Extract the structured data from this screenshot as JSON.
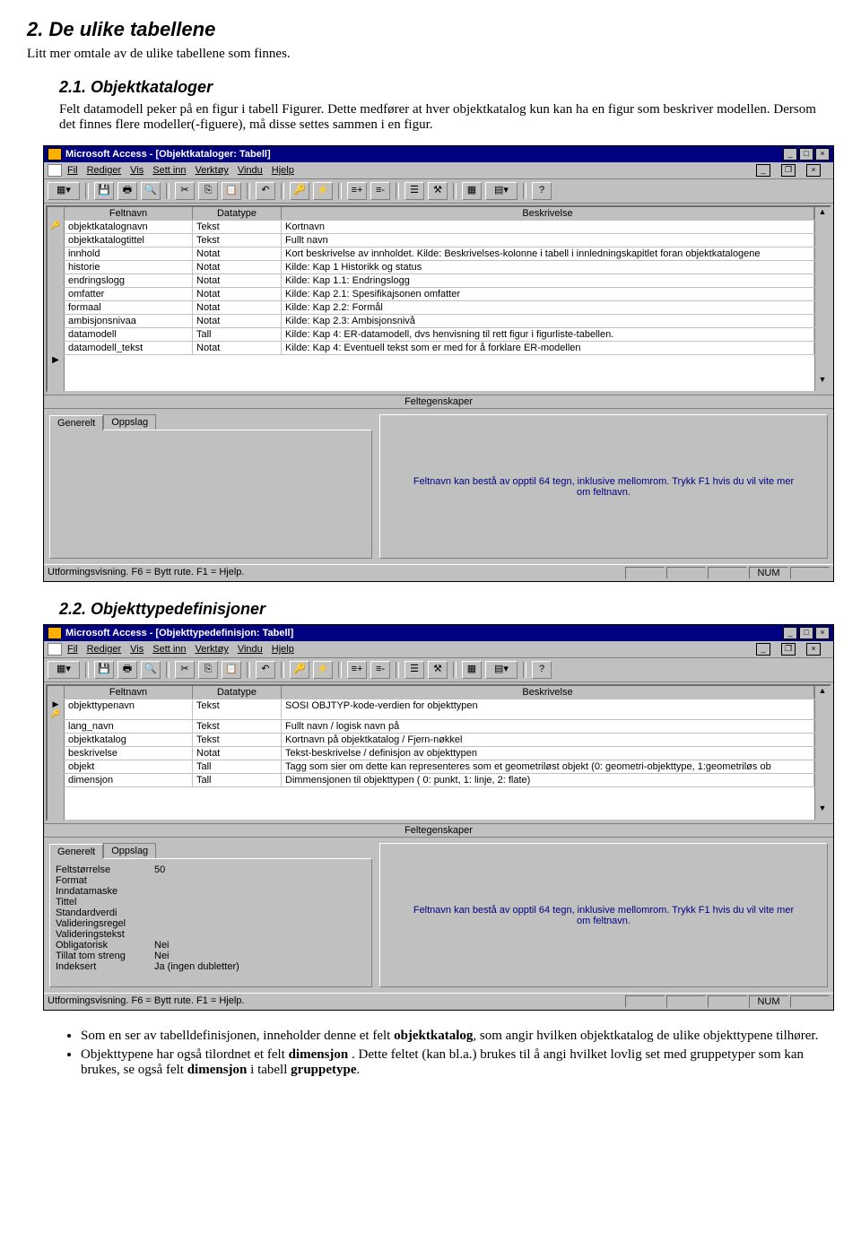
{
  "doc": {
    "h2": "2.  De ulike tabellene",
    "intro": "Litt mer omtale av de ulike tabellene som finnes.",
    "s21_title": "2.1.  Objektkataloger",
    "s21_text": "Felt datamodell peker på en figur i tabell Figurer. Dette medfører at hver objektkatalog kun kan ha en figur som beskriver modellen. Dersom det finnes flere modeller(-figuere), må disse settes sammen i en figur.",
    "s22_title": "2.2.  Objekttypedefinisjoner",
    "bullet1_a": "Som en ser av tabelldefinisjonen, inneholder denne et felt ",
    "bullet1_bold": "objektkatalog",
    "bullet1_b": ", som angir hvilken objektkatalog de ulike objekttypene tilhører.",
    "bullet2_a": "Objekttypene har også tilordnet et felt ",
    "bullet2_bold": "dimensjon",
    "bullet2_b": " . Dette feltet (kan bl.a.) brukes til å angi hvilket lovlig set med gruppetyper som kan brukes, se også felt ",
    "bullet2_bold2": "dimensjon",
    "bullet2_c": " i tabell ",
    "bullet2_bold3": "gruppetype",
    "bullet2_d": "."
  },
  "win1": {
    "title": "Microsoft Access - [Objektkataloger: Tabell]",
    "menu": [
      "Fil",
      "Rediger",
      "Vis",
      "Sett inn",
      "Verktøy",
      "Vindu",
      "Hjelp"
    ],
    "headers": [
      "Feltnavn",
      "Datatype",
      "Beskrivelse"
    ],
    "rows": [
      {
        "pk": true,
        "f": "objektkatalognavn",
        "d": "Tekst",
        "b": "Kortnavn"
      },
      {
        "f": "objektkatalogtittel",
        "d": "Tekst",
        "b": "Fullt navn"
      },
      {
        "f": "innhold",
        "d": "Notat",
        "b": "Kort beskrivelse av innholdet. Kilde: Beskrivelses-kolonne i tabell i innledningskapitlet foran objektkatalogene"
      },
      {
        "f": "historie",
        "d": "Notat",
        "b": "Kilde: Kap 1 Historikk og status"
      },
      {
        "f": "endringslogg",
        "d": "Notat",
        "b": "Kilde: Kap 1.1: Endringslogg"
      },
      {
        "f": "omfatter",
        "d": "Notat",
        "b": "Kilde: Kap 2.1: Spesifikajsonen omfatter"
      },
      {
        "f": "formaal",
        "d": "Notat",
        "b": "Kilde: Kap 2.2: Formål"
      },
      {
        "f": "ambisjonsnivaa",
        "d": "Notat",
        "b": "Kilde: Kap 2.3: Ambisjonsnivå"
      },
      {
        "f": "datamodell",
        "d": "Tall",
        "b": "Kilde: Kap 4: ER-datamodell, dvs henvisning til rett figur i figurliste-tabellen."
      },
      {
        "f": "datamodell_tekst",
        "d": "Notat",
        "b": "Kilde: Kap 4: Eventuell tekst som er med for å forklare ER-modellen"
      }
    ],
    "section_label": "Feltegenskaper",
    "tab1": "Generelt",
    "tab2": "Oppslag",
    "help": "Feltnavn kan bestå av opptil 64 tegn, inklusive mellomrom. Trykk F1 hvis du vil vite mer om feltnavn.",
    "status": "Utformingsvisning. F6 = Bytt rute. F1 = Hjelp.",
    "num": "NUM"
  },
  "win2": {
    "title": "Microsoft Access - [Objekttypedefinisjon: Tabell]",
    "menu": [
      "Fil",
      "Rediger",
      "Vis",
      "Sett inn",
      "Verktøy",
      "Vindu",
      "Hjelp"
    ],
    "headers": [
      "Feltnavn",
      "Datatype",
      "Beskrivelse"
    ],
    "rows": [
      {
        "pk": true,
        "sel": true,
        "f": "objekttypenavn",
        "d": "Tekst",
        "b": "SOSI OBJTYP-kode-verdien for objekttypen"
      },
      {
        "f": "lang_navn",
        "d": "Tekst",
        "b": "Fullt navn / logisk navn på"
      },
      {
        "f": "objektkatalog",
        "d": "Tekst",
        "b": "Kortnavn på objektkatalog / Fjern-nøkkel"
      },
      {
        "f": "beskrivelse",
        "d": "Notat",
        "b": "Tekst-beskrivelse / definisjon av objekttypen"
      },
      {
        "f": "objekt",
        "d": "Tall",
        "b": "Tagg som sier om dette kan representeres som et geometriløst objekt (0: geometri-objekttype, 1:geometriløs ob"
      },
      {
        "f": "dimensjon",
        "d": "Tall",
        "b": "Dimmensjonen til objekttypen ( 0: punkt, 1: linje, 2: flate)"
      }
    ],
    "section_label": "Feltegenskaper",
    "tab1": "Generelt",
    "tab2": "Oppslag",
    "props": [
      {
        "l": "Feltstørrelse",
        "v": "50"
      },
      {
        "l": "Format",
        "v": ""
      },
      {
        "l": "Inndatamaske",
        "v": ""
      },
      {
        "l": "Tittel",
        "v": ""
      },
      {
        "l": "Standardverdi",
        "v": ""
      },
      {
        "l": "Valideringsregel",
        "v": ""
      },
      {
        "l": "Valideringstekst",
        "v": ""
      },
      {
        "l": "Obligatorisk",
        "v": "Nei"
      },
      {
        "l": "Tillat tom streng",
        "v": "Nei"
      },
      {
        "l": "Indeksert",
        "v": "Ja (ingen dubletter)"
      }
    ],
    "help": "Feltnavn kan bestå av opptil 64 tegn, inklusive mellomrom. Trykk F1 hvis du vil vite mer om feltnavn.",
    "status": "Utformingsvisning. F6 = Bytt rute. F1 = Hjelp.",
    "num": "NUM"
  }
}
